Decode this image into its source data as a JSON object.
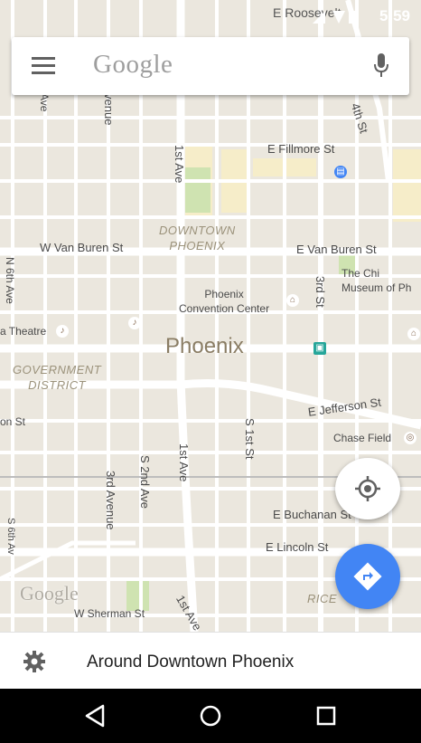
{
  "status_bar": {
    "street_fragment": "E Roosevelt",
    "time": "5:59"
  },
  "search": {
    "logo": "Google"
  },
  "map": {
    "streets": {
      "e_fillmore": "E Fillmore St",
      "w_van_buren": "W Van Buren St",
      "e_van_buren": "E Van Buren St",
      "first_ave_top": "1st Ave",
      "first_ave_mid": "1st Ave",
      "first_ave_low": "1st Ave",
      "third_st": "3rd St",
      "e_jefferson": "E Jefferson St",
      "s_1st_st": "S 1st St",
      "s_2nd_ave": "S 2nd Ave",
      "third_avenue_top": "3rd Avenue",
      "e_buchanan": "E Buchanan St",
      "e_lincoln": "E Lincoln St",
      "w_sherman": "W Sherman St",
      "n_6th_ave": "N 6th Ave",
      "fourth_st": "4th St",
      "on_st": "on St",
      "avenue_top": "Avenue",
      "nue": "venue",
      "ave_left": "Ave",
      "s_6th": "S 6th Av"
    },
    "places": {
      "downtown_phoenix": "DOWNTOWN\nPHOENIX",
      "phoenix": "Phoenix",
      "convention_center": "Phoenix\nConvention Center",
      "childrens_museum": "The Chi\nMuseum of Ph",
      "theatre": "a Theatre",
      "government_district": "GOVERNMENT\nDISTRICT",
      "chase_field": "Chase Field",
      "rice": "RICE"
    },
    "watermark": "Google"
  },
  "bottom_card": {
    "title": "Around Downtown Phoenix"
  },
  "colors": {
    "accent": "#4285f4",
    "map_bg": "#ebe7de",
    "road": "#ffffff",
    "park": "#cfe3b1",
    "block": "#f6edc9"
  },
  "icons": {
    "menu": "menu-icon",
    "mic": "mic-icon",
    "locate": "my-location-icon",
    "directions": "directions-icon",
    "settings": "gear-icon",
    "back": "back-icon",
    "home": "home-icon",
    "recents": "recents-icon"
  }
}
